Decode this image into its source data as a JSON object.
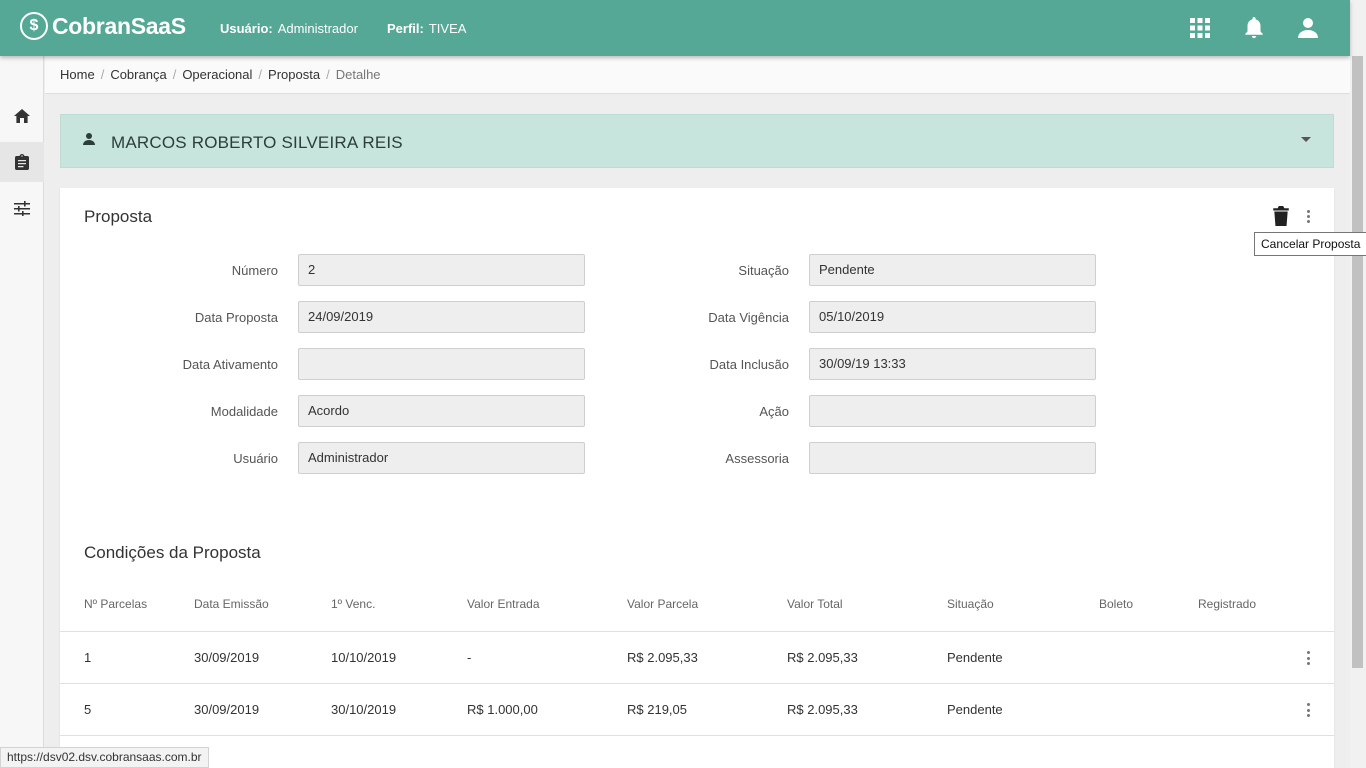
{
  "app": {
    "brand": "CobranSaaS",
    "logo_symbol": "$",
    "user_label": "Usuário:",
    "user_value": "Administrador",
    "profile_label": "Perfil:",
    "profile_value": "TIVEA",
    "accent_color": "#55a896"
  },
  "top_icons": [
    "apps-grid-icon",
    "bell-icon",
    "user-account-icon"
  ],
  "sidebar": {
    "items": [
      {
        "icon": "home-icon"
      },
      {
        "icon": "clipboard-icon",
        "active": true
      },
      {
        "icon": "sliders-icon"
      }
    ]
  },
  "breadcrumb": [
    "Home",
    "Cobrança",
    "Operacional",
    "Proposta",
    "Detalhe"
  ],
  "customer": {
    "name": "MARCOS ROBERTO SILVEIRA REIS"
  },
  "proposta": {
    "title": "Proposta",
    "tooltip": "Cancelar Proposta",
    "fields": [
      {
        "label": "Número",
        "value": "2"
      },
      {
        "label": "Situação",
        "value": "Pendente"
      },
      {
        "label": "Data Proposta",
        "value": "24/09/2019"
      },
      {
        "label": "Data Vigência",
        "value": "05/10/2019"
      },
      {
        "label": "Data Ativamento",
        "value": ""
      },
      {
        "label": "Data Inclusão",
        "value": "30/09/19 13:33"
      },
      {
        "label": "Modalidade",
        "value": "Acordo"
      },
      {
        "label": "Ação",
        "value": ""
      },
      {
        "label": "Usuário",
        "value": "Administrador"
      },
      {
        "label": "Assessoria",
        "value": ""
      }
    ]
  },
  "condicoes": {
    "title": "Condições da Proposta",
    "columns": [
      "Nº Parcelas",
      "Data Emissão",
      "1º Venc.",
      "Valor Entrada",
      "Valor Parcela",
      "Valor Total",
      "Situação",
      "Boleto",
      "Registrado"
    ],
    "rows": [
      [
        "1",
        "30/09/2019",
        "10/10/2019",
        "-",
        "R$ 2.095,33",
        "R$ 2.095,33",
        "Pendente",
        "",
        ""
      ],
      [
        "5",
        "30/09/2019",
        "30/10/2019",
        "R$ 1.000,00",
        "R$ 219,05",
        "R$ 2.095,33",
        "Pendente",
        "",
        ""
      ]
    ]
  },
  "status_url": "https://dsv02.dsv.cobransaas.com.br"
}
